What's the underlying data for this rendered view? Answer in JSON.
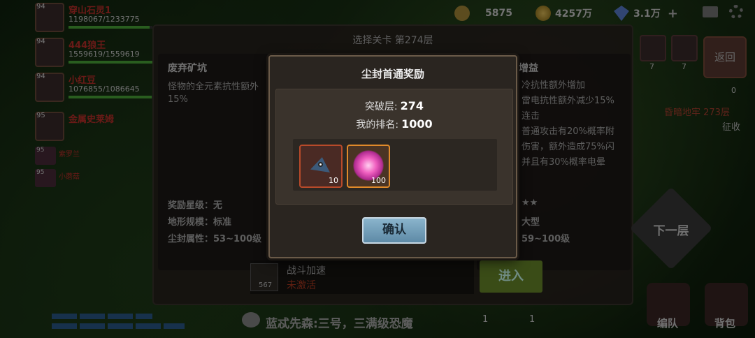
{
  "resources": [
    {
      "icon": "wheat-icon",
      "value": "5875"
    },
    {
      "icon": "gold-coin-icon",
      "value": "4257万"
    },
    {
      "icon": "diamond-icon",
      "value": "3.1万"
    }
  ],
  "team": [
    {
      "level": "94",
      "name": "穿山石灵1",
      "hp": "1198067/1233775",
      "hp_fraction": 0.97
    },
    {
      "level": "94",
      "name": "444狼王",
      "hp": "1559619/1559619",
      "hp_fraction": 1.0
    },
    {
      "level": "94",
      "name": "小红豆",
      "hp": "1076855/1086645",
      "hp_fraction": 0.99
    },
    {
      "level": "95",
      "name": "金属史莱姆",
      "hp": "",
      "hp_fraction": null
    }
  ],
  "mini_team": [
    {
      "level": "95",
      "name": "紫罗兰"
    },
    {
      "level": "95",
      "name": "小蘑菇"
    }
  ],
  "stage": {
    "title": "选择关卡 第274层",
    "left_card": {
      "title": "废弃矿坑",
      "desc_lines": [
        "怪物的全元素抗性额外",
        "15%"
      ],
      "stats": [
        "奖励星级：无",
        "地形规模：标准",
        "尘封属性：53~100级"
      ]
    },
    "right_card": {
      "title": "增益",
      "desc_lines": [
        "冷抗性额外增加",
        "雷电抗性额外减少15%",
        "连击",
        "普通攻击有20%概率附",
        "伤害，额外造成75%闪",
        "并且有30%概率电晕"
      ],
      "stats": [
        "★★",
        "大型",
        "59~100级"
      ]
    },
    "accel": {
      "label": "战斗加速",
      "status": "未激活",
      "count": "567"
    },
    "enter_label": "进入"
  },
  "right_panel": {
    "back_label": "返回",
    "counts": [
      "7",
      "7"
    ],
    "key_count": "0",
    "dungeon_label": "昏暗地牢 273层",
    "collect_label": "征收",
    "next_label": "下一层",
    "bottom": [
      {
        "label": "编队"
      },
      {
        "label": "背包"
      }
    ]
  },
  "chat": {
    "message": "蓝忒先森:三号，三满级恐魔",
    "counts": [
      "1",
      "1"
    ]
  },
  "modal": {
    "title": "尘封首通奖励",
    "floor_label": "突破层:",
    "floor_value": "274",
    "rank_label": "我的排名:",
    "rank_value": "1000",
    "rewards": [
      {
        "icon": "dark-shard-icon",
        "qty": "10",
        "rarity_color": "#b84a2a"
      },
      {
        "icon": "pink-orb-icon",
        "qty": "100",
        "rarity_color": "#e08a2a"
      }
    ],
    "confirm_label": "确认"
  }
}
